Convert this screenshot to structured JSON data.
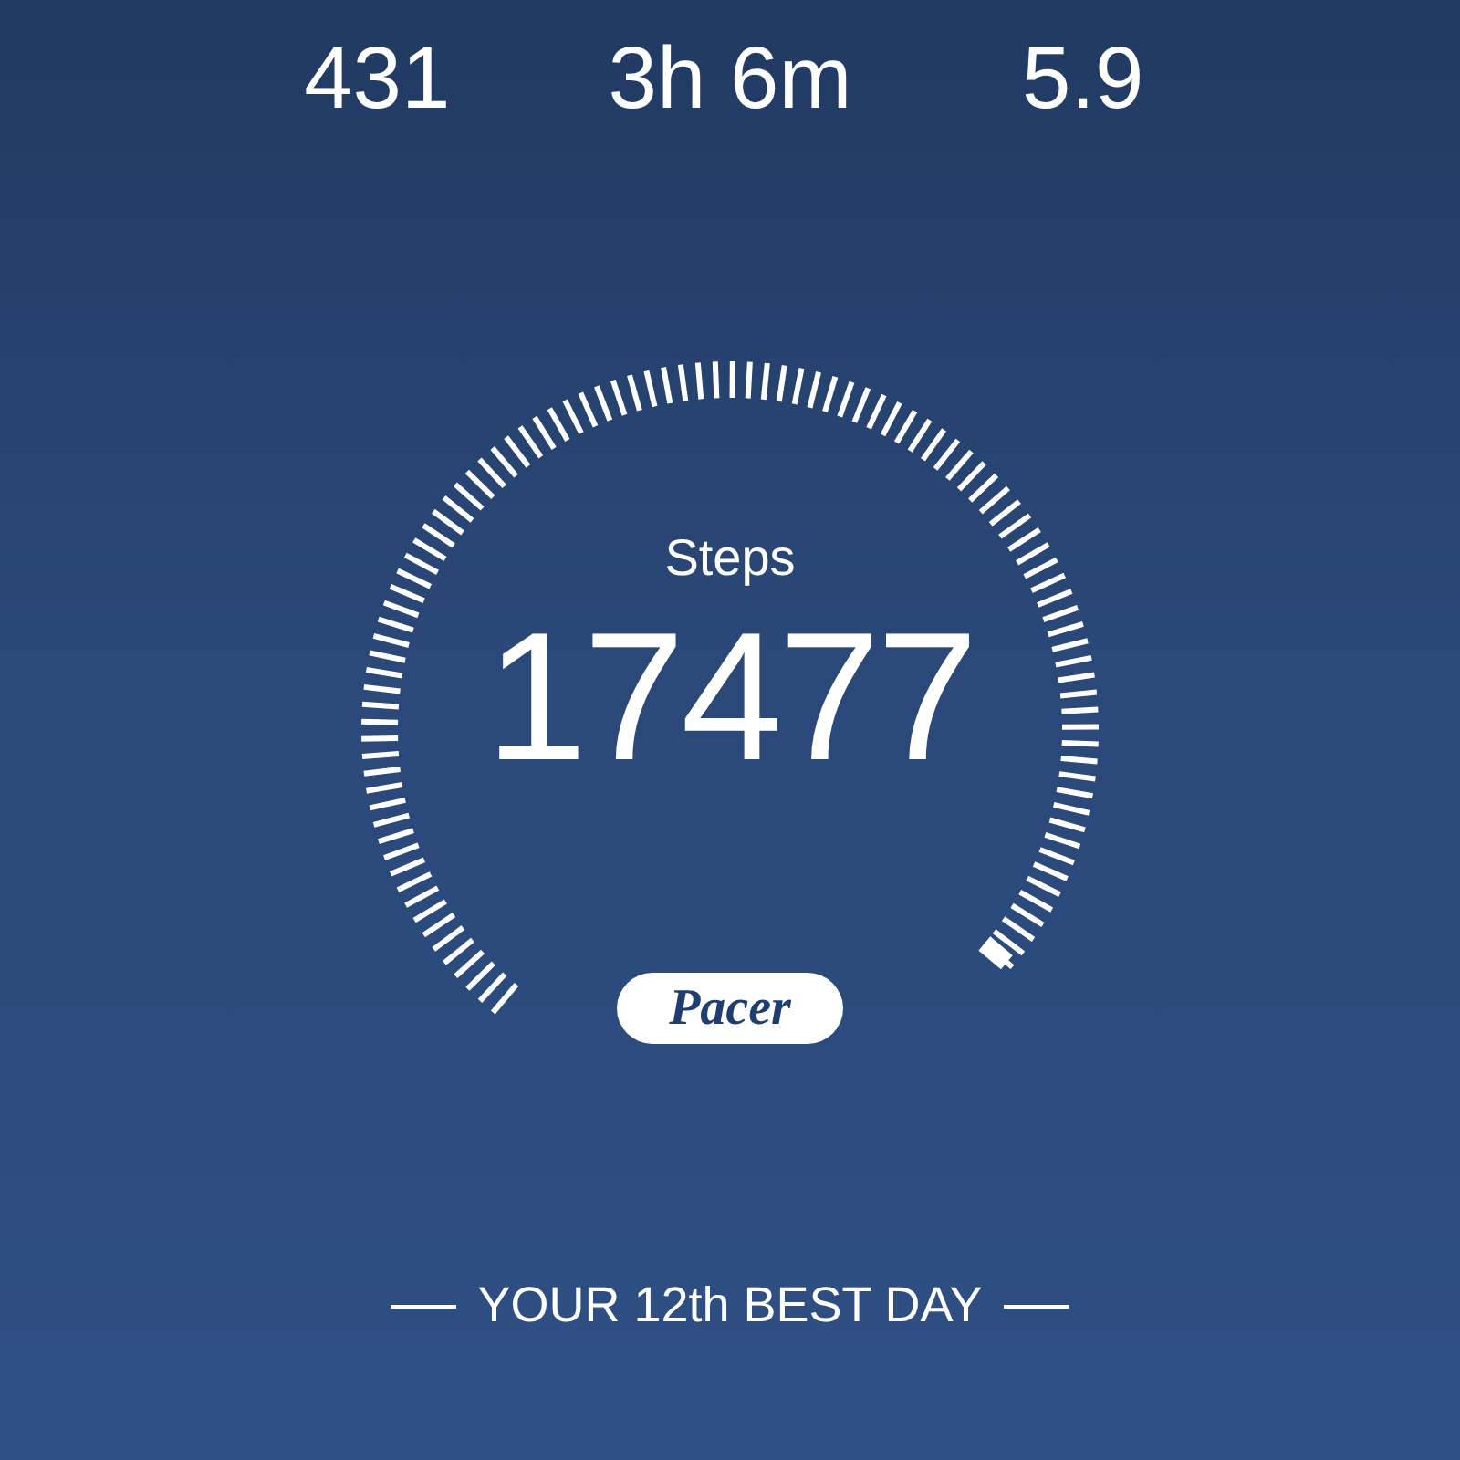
{
  "stats": [
    {
      "value": "431"
    },
    {
      "value": "3h 6m"
    },
    {
      "value": "5.9"
    }
  ],
  "gauge": {
    "label": "Steps",
    "value": "17477"
  },
  "logo_badge": "Pacer",
  "footer": "YOUR 12th BEST DAY"
}
